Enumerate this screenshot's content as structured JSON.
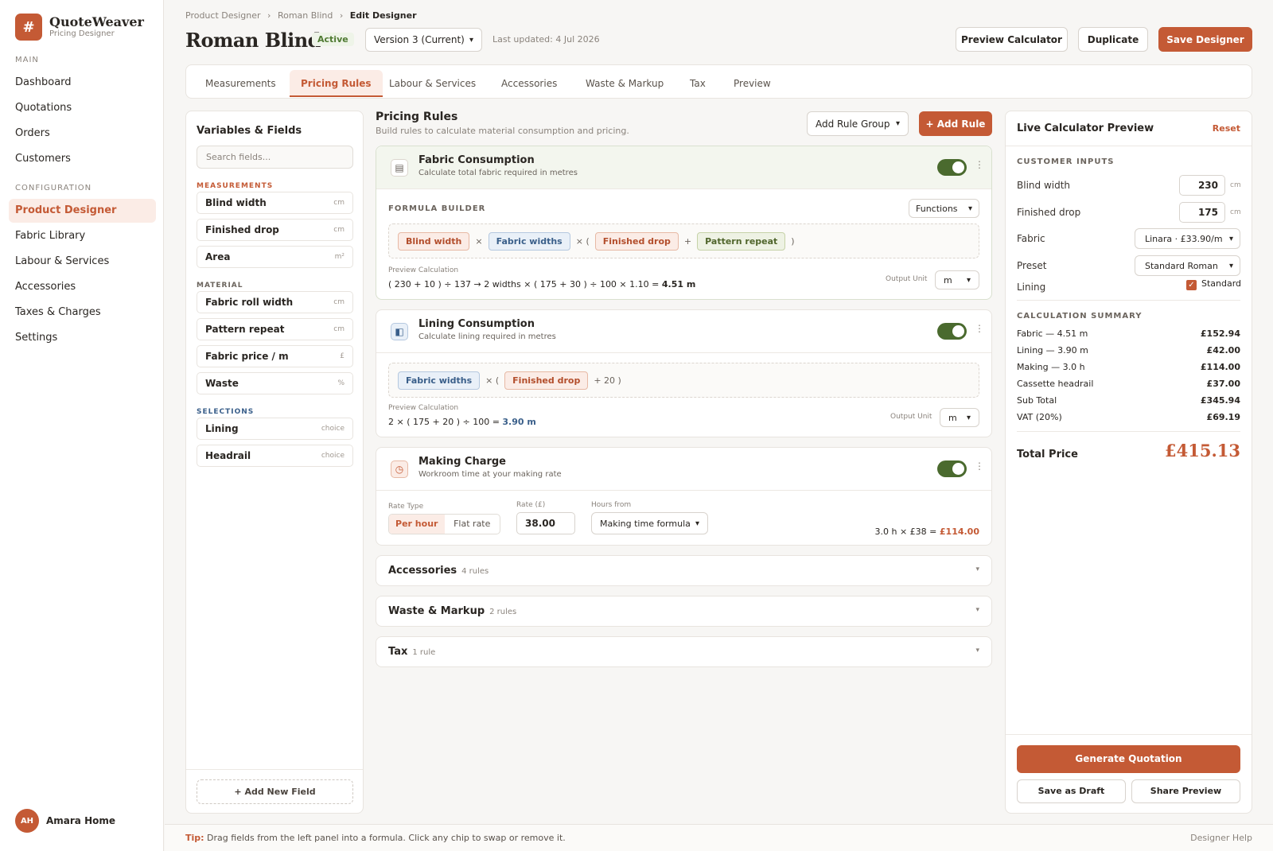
{
  "brand": {
    "name": "QuoteWeaver",
    "sub": "Pricing Designer",
    "logo_glyph": "#"
  },
  "nav": {
    "main_label": "MAIN",
    "main_items": [
      "Dashboard",
      "Quotations",
      "Orders",
      "Customers"
    ],
    "config_label": "CONFIGURATION",
    "config_items": [
      "Product Designer",
      "Fabric Library",
      "Labour & Services",
      "Accessories",
      "Taxes & Charges",
      "Settings"
    ],
    "active": "Product Designer"
  },
  "user": {
    "initials": "AH",
    "name": "Amara Home"
  },
  "breadcrumb": {
    "a": "Product Designer",
    "b": "Roman Blind",
    "c": "Edit Designer",
    "sep": "›"
  },
  "header": {
    "title": "Roman Blind",
    "status": "Active",
    "version": "Version 3 (Current)",
    "updated": "Last updated: 4 Jul 2026",
    "preview_btn": "Preview Calculator",
    "duplicate_btn": "Duplicate",
    "save_btn": "Save Designer"
  },
  "tabs": [
    "Measurements",
    "Pricing Rules",
    "Labour & Services",
    "Accessories",
    "Waste & Markup",
    "Tax",
    "Preview"
  ],
  "variables": {
    "title": "Variables & Fields",
    "search_placeholder": "Search fields...",
    "groups": [
      {
        "label": "MEASUREMENTS",
        "color": "#c45a35",
        "fields": [
          {
            "name": "Blind width",
            "unit": "cm"
          },
          {
            "name": "Finished drop",
            "unit": "cm"
          },
          {
            "name": "Area",
            "unit": "m²"
          }
        ]
      },
      {
        "label": "MATERIAL",
        "color": "#6b645d",
        "fields": [
          {
            "name": "Fabric roll width",
            "unit": "cm"
          },
          {
            "name": "Pattern repeat",
            "unit": "cm"
          },
          {
            "name": "Fabric price / m",
            "unit": "£"
          },
          {
            "name": "Waste",
            "unit": "%"
          }
        ]
      },
      {
        "label": "SELECTIONS",
        "color": "#3a5f8a",
        "fields": [
          {
            "name": "Lining",
            "unit": "choice"
          },
          {
            "name": "Headrail",
            "unit": "choice"
          }
        ]
      }
    ],
    "add_field": "+ Add New Field"
  },
  "pricing": {
    "title": "Pricing Rules",
    "subtitle": "Build rules to calculate material consumption and pricing.",
    "add_group": "Add Rule Group",
    "add_rule": "+ Add Rule"
  },
  "fabric_rule": {
    "title": "Fabric Consumption",
    "desc": "Calculate total fabric required in metres",
    "builder_label": "FORMULA BUILDER",
    "functions": "Functions",
    "chips": [
      "Blind width",
      "Fabric widths",
      "Finished drop",
      "Pattern repeat"
    ],
    "ops": [
      "×",
      "× (",
      "+",
      ")"
    ],
    "preview_label": "Preview Calculation",
    "preview": "( 230 + 10 ) ÷ 137 → 2 widths × ( 175 + 30 ) ÷ 100 × 1.10 =",
    "result": "4.51 m",
    "output_label": "Output Unit",
    "output_unit": "m"
  },
  "lining_rule": {
    "title": "Lining Consumption",
    "desc": "Calculate lining required in metres",
    "chips": [
      "Fabric widths",
      "Finished drop"
    ],
    "ops": [
      "× (",
      "+ 20 )"
    ],
    "preview_label": "Preview Calculation",
    "preview": "2 × ( 175 + 20 ) ÷ 100 =",
    "result": "3.90 m",
    "output_label": "Output Unit",
    "output_unit": "m"
  },
  "making_rule": {
    "title": "Making Charge",
    "desc": "Workroom time at your making rate",
    "rate_type_label": "Rate Type",
    "rate_types": [
      "Per hour",
      "Flat rate"
    ],
    "rate_label": "Rate (£)",
    "rate": "38.00",
    "hours_label": "Hours from",
    "hours_from": "Making time formula",
    "calc": "3.0 h × £38 =",
    "result": "£114.00"
  },
  "collapsed": [
    {
      "title": "Accessories",
      "count": "4 rules"
    },
    {
      "title": "Waste & Markup",
      "count": "2 rules"
    },
    {
      "title": "Tax",
      "count": "1 rule"
    }
  ],
  "calculator": {
    "title": "Live Calculator Preview",
    "reset": "Reset",
    "inputs_label": "CUSTOMER INPUTS",
    "blind_width_label": "Blind width",
    "blind_width": "230",
    "drop_label": "Finished drop",
    "drop": "175",
    "unit": "cm",
    "fabric_label": "Fabric",
    "fabric": "Linara · £33.90/m",
    "preset_label": "Preset",
    "preset": "Standard Roman",
    "lining_label": "Lining",
    "lining_value": "Standard",
    "summary_label": "CALCULATION SUMMARY",
    "summary": [
      {
        "label": "Fabric — 4.51 m",
        "value": "£152.94"
      },
      {
        "label": "Lining — 3.90 m",
        "value": "£42.00"
      },
      {
        "label": "Making — 3.0 h",
        "value": "£114.00"
      },
      {
        "label": "Cassette headrail",
        "value": "£37.00"
      },
      {
        "label": "Sub Total",
        "value": "£345.94"
      },
      {
        "label": "VAT (20%)",
        "value": "£69.19"
      }
    ],
    "total_label": "Total Price",
    "total": "£415.13",
    "generate": "Generate Quotation",
    "draft": "Save as Draft",
    "share": "Share Preview"
  },
  "footer": {
    "tip_label": "Tip:",
    "tip": "Drag fields from the left panel into a formula. Click any chip to swap or remove it.",
    "help": "Designer Help"
  }
}
